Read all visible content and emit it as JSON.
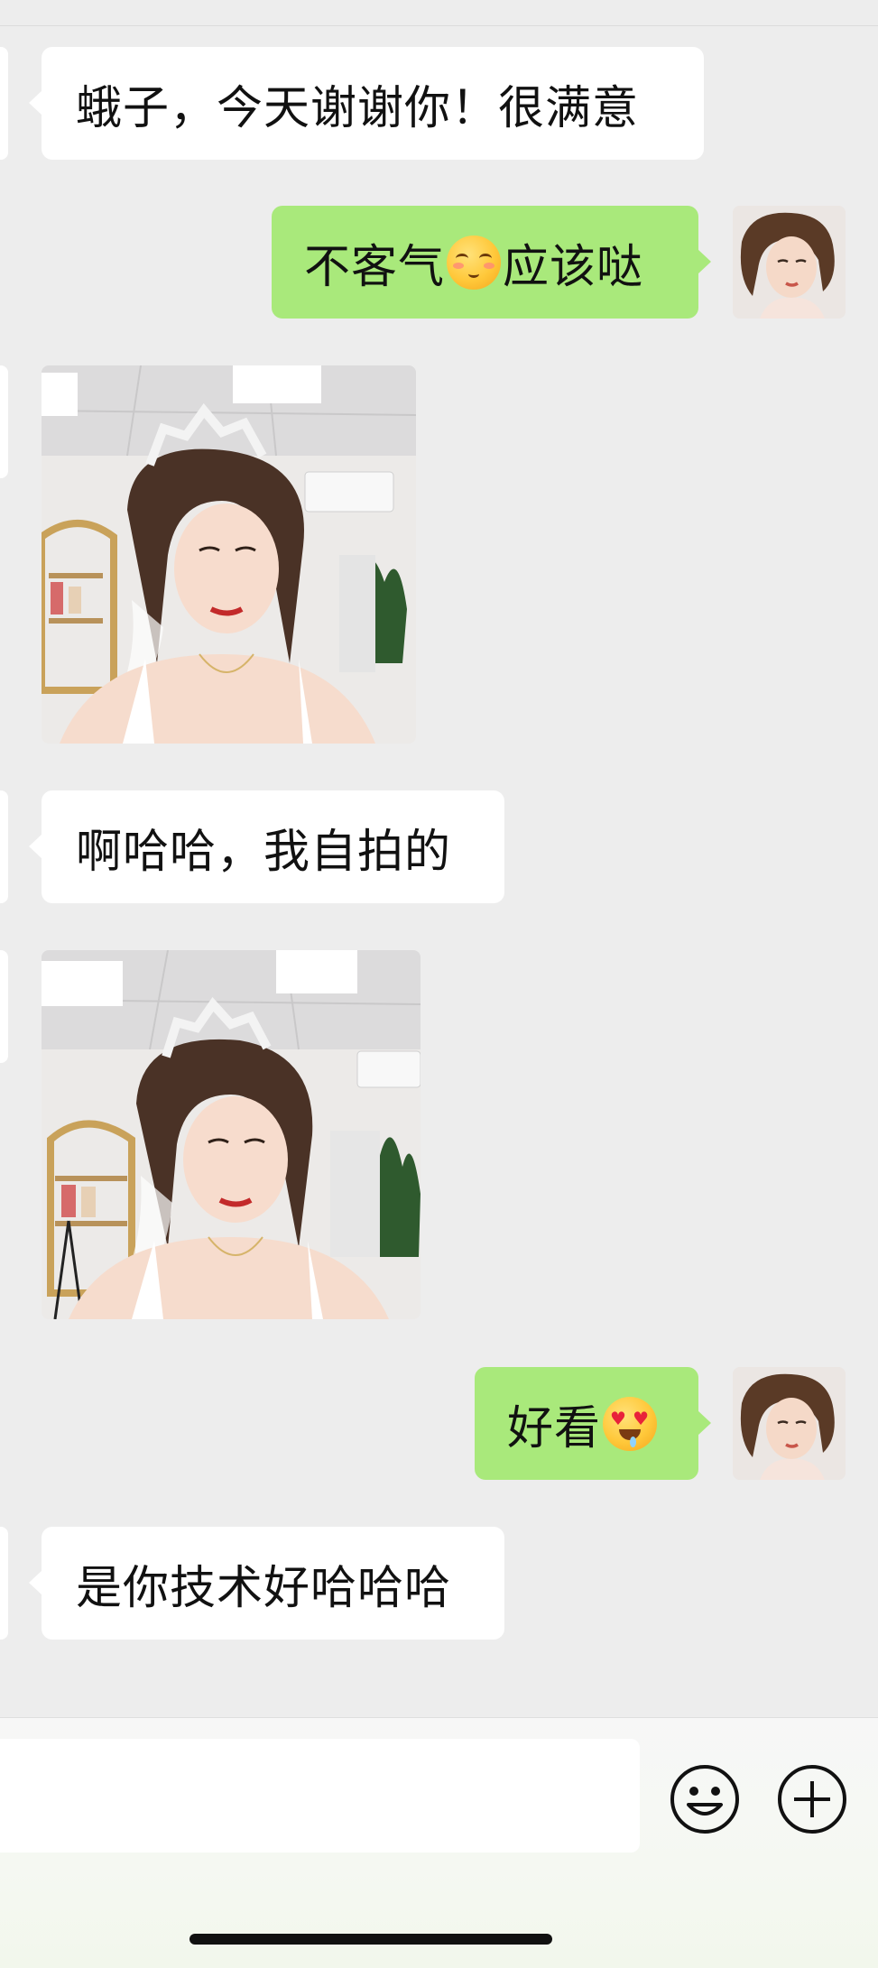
{
  "messages": [
    {
      "direction": "incoming",
      "type": "text",
      "text": "蛾子，今天谢谢你！很满意"
    },
    {
      "direction": "outgoing",
      "type": "text",
      "text_before": "不客气",
      "emoji": "shy-smile-emoji",
      "text_after": "应该哒"
    },
    {
      "direction": "incoming",
      "type": "image",
      "description": "bride selfie with tiara"
    },
    {
      "direction": "incoming",
      "type": "text",
      "text": "啊哈哈，我自拍的"
    },
    {
      "direction": "incoming",
      "type": "image",
      "description": "bride selfie with tiara and veil"
    },
    {
      "direction": "outgoing",
      "type": "text",
      "text_before": "好看",
      "emoji": "heart-eyes-emoji",
      "text_after": ""
    },
    {
      "direction": "incoming",
      "type": "text",
      "text": "是你技术好哈哈哈"
    }
  ],
  "input_bar": {
    "icons": [
      "smiley-face-icon",
      "plus-circle-icon"
    ]
  },
  "colors": {
    "background": "#ededed",
    "incoming_bubble": "#ffffff",
    "outgoing_bubble": "#a9e97b",
    "text": "#111111"
  }
}
